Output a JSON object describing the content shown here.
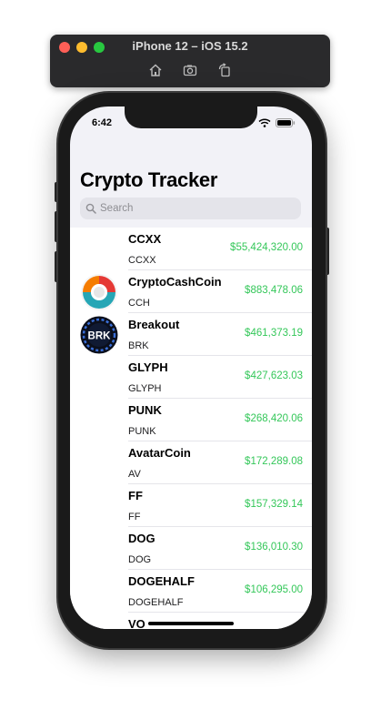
{
  "simulator": {
    "title": "iPhone 12 – iOS 15.2",
    "tools": [
      "home-icon",
      "screenshot-icon",
      "rotate-icon"
    ]
  },
  "status_bar": {
    "time": "6:42"
  },
  "nav": {
    "title": "Crypto Tracker"
  },
  "search": {
    "placeholder": "Search",
    "value": ""
  },
  "colors": {
    "price": "#34c759",
    "background": "#f2f2f7"
  },
  "coins": [
    {
      "name": "CCXX",
      "symbol": "CCXX",
      "price": "$55,424,320.00",
      "logo": ""
    },
    {
      "name": "CryptoCashCoin",
      "symbol": "CCH",
      "price": "$883,478.06",
      "logo": "cryptocashcoin-logo"
    },
    {
      "name": "Breakout",
      "symbol": "BRK",
      "price": "$461,373.19",
      "logo": "breakout-logo",
      "logo_text": "BRK"
    },
    {
      "name": "GLYPH",
      "symbol": "GLYPH",
      "price": "$427,623.03",
      "logo": ""
    },
    {
      "name": "PUNK",
      "symbol": "PUNK",
      "price": "$268,420.06",
      "logo": ""
    },
    {
      "name": "AvatarCoin",
      "symbol": "AV",
      "price": "$172,289.08",
      "logo": ""
    },
    {
      "name": "FF",
      "symbol": "FF",
      "price": "$157,329.14",
      "logo": ""
    },
    {
      "name": "DOG",
      "symbol": "DOG",
      "price": "$136,010.30",
      "logo": ""
    },
    {
      "name": "DOGEHALF",
      "symbol": "DOGEHALF",
      "price": "$106,295.00",
      "logo": ""
    },
    {
      "name": "VO",
      "symbol": "",
      "price": "",
      "logo": ""
    }
  ]
}
